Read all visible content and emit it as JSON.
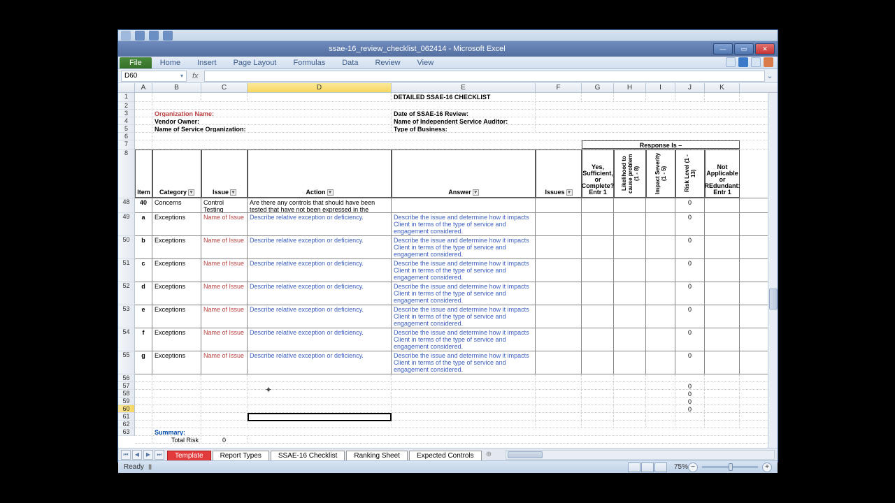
{
  "window": {
    "title": "ssae-16_review_checklist_062414 - Microsoft Excel"
  },
  "ribbon": {
    "file": "File",
    "tabs": [
      "Home",
      "Insert",
      "Page Layout",
      "Formulas",
      "Data",
      "Review",
      "View"
    ]
  },
  "namebox": "D60",
  "columns": [
    "A",
    "B",
    "C",
    "D",
    "E",
    "F",
    "G",
    "H",
    "I",
    "J",
    "K"
  ],
  "rownums": [
    "1",
    "2",
    "3",
    "4",
    "5",
    "6",
    "7",
    "8",
    "48",
    "49",
    "50",
    "51",
    "52",
    "53",
    "54",
    "55",
    "56",
    "57",
    "58",
    "59",
    "60",
    "61",
    "62",
    "63"
  ],
  "doc": {
    "title": "DETAILED SSAE-16 CHECKLIST",
    "org": "Organization Name:",
    "vendor": "Vendor Owner:",
    "svcorg": "Name of Service Organization:",
    "date": "Date of SSAE-16 Review:",
    "auditor": "Name of Independent Service Auditor:",
    "biz": "Type of Business:",
    "response": "Response Is –"
  },
  "headers": {
    "item": "Item",
    "category": "Category",
    "issue": "Issue",
    "action": "Action",
    "answer": "Answer",
    "issues": "Issues",
    "g": "Yes, Sufficient, or Complete? Entr 1",
    "h": "Likelihood to cause problem (1 - 8)",
    "i": "Impact Severity (1 - 5)",
    "j": "Risk Level (1 - 13)",
    "k": "Not Applicable or REdundant: Entr 1"
  },
  "rows": [
    {
      "item": "40",
      "cat": "Concerns",
      "issue": "Control Testing",
      "action": "Are there any controls that should have been tested that have not been expressed in the report?",
      "answer": "",
      "j": "0"
    },
    {
      "item": "a",
      "cat": "Exceptions",
      "issue": "Name of Issue",
      "action": "Describe relative exception or deficiency.",
      "answer": "Describe the issue and determine how it impacts Client in terms of the type of service and engagement considered.",
      "j": "0"
    },
    {
      "item": "b",
      "cat": "Exceptions",
      "issue": "Name of Issue",
      "action": "Describe relative exception or deficiency.",
      "answer": "Describe the issue and determine how it impacts Client in terms of the type of service and engagement considered.",
      "j": "0"
    },
    {
      "item": "c",
      "cat": "Exceptions",
      "issue": "Name of Issue",
      "action": "Describe relative exception or deficiency.",
      "answer": "Describe the issue and determine how it impacts Client in terms of the type of service and engagement considered.",
      "j": "0"
    },
    {
      "item": "d",
      "cat": "Exceptions",
      "issue": "Name of Issue",
      "action": "Describe relative exception or deficiency.",
      "answer": "Describe the issue and determine how it impacts Client in terms of the type of service and engagement considered.",
      "j": "0"
    },
    {
      "item": "e",
      "cat": "Exceptions",
      "issue": "Name of Issue",
      "action": "Describe relative exception or deficiency.",
      "answer": "Describe the issue and determine how it impacts Client in terms of the type of service and engagement considered.",
      "j": "0"
    },
    {
      "item": "f",
      "cat": "Exceptions",
      "issue": "Name of Issue",
      "action": "Describe relative exception or deficiency.",
      "answer": "Describe the issue and determine how it impacts Client in terms of the type of service and engagement considered.",
      "j": "0"
    },
    {
      "item": "g",
      "cat": "Exceptions",
      "issue": "Name of Issue",
      "action": "Describe relative exception or deficiency.",
      "answer": "Describe the issue and determine how it impacts Client in terms of the type of service and engagement considered.",
      "j": "0"
    }
  ],
  "summary": {
    "label": "Summary:",
    "totalrisk": "Total Risk",
    "val": "0"
  },
  "sheets": [
    "Template",
    "Report Types",
    "SSAE-16 Checklist",
    "Ranking Sheet",
    "Expected Controls"
  ],
  "status": {
    "ready": "Ready",
    "zoom": "75%"
  }
}
